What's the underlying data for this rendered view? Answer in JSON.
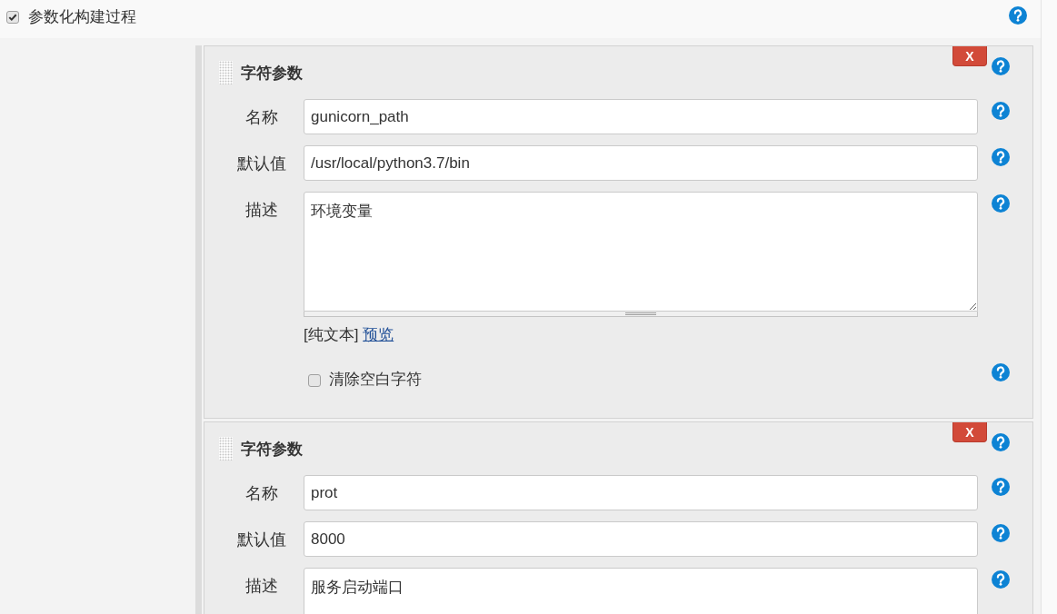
{
  "build_parameters": {
    "label": "参数化构建过程",
    "checked": true
  },
  "parameters": [
    {
      "title": "字符参数",
      "delete_button": "X",
      "fields": [
        {
          "kind": "text",
          "label": "名称",
          "value": "gunicorn_path"
        },
        {
          "kind": "text",
          "label": "默认值",
          "value": "/usr/local/python3.7/bin"
        },
        {
          "kind": "textarea",
          "label": "描述",
          "value": "环境变量"
        }
      ],
      "format": {
        "mode": "[纯文本]",
        "preview_link": "预览"
      },
      "trim": {
        "label": "清除空白字符",
        "checked": false
      }
    },
    {
      "title": "字符参数",
      "delete_button": "X",
      "fields": [
        {
          "kind": "text",
          "label": "名称",
          "value": "prot"
        },
        {
          "kind": "text",
          "label": "默认值",
          "value": "8000"
        },
        {
          "kind": "textarea",
          "label": "描述",
          "value": "服务启动端口"
        }
      ]
    }
  ]
}
